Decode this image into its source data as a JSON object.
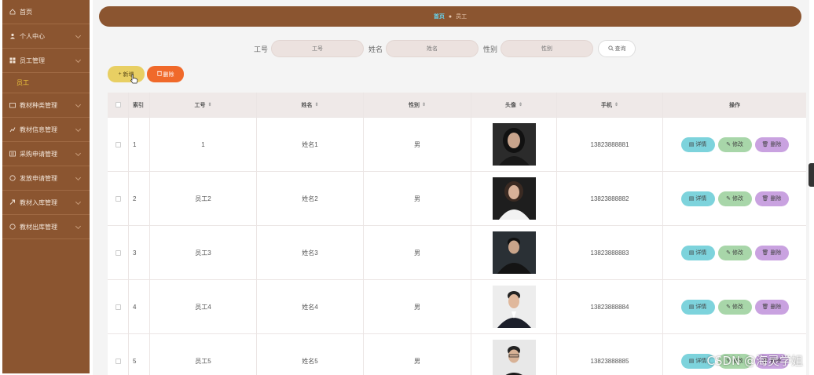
{
  "sidebar": {
    "items": [
      {
        "label": "首页",
        "icon": "home-icon"
      },
      {
        "label": "个人中心",
        "icon": "user-icon"
      },
      {
        "label": "员工管理",
        "icon": "grid-icon"
      },
      {
        "label": "教材种类管理",
        "icon": "folder-icon"
      },
      {
        "label": "教材信息管理",
        "icon": "chart-icon"
      },
      {
        "label": "采购申请管理",
        "icon": "list-icon"
      },
      {
        "label": "发放申请管理",
        "icon": "circle-icon"
      },
      {
        "label": "教材入库管理",
        "icon": "box-icon"
      },
      {
        "label": "教材出库管理",
        "icon": "circle-icon"
      }
    ],
    "sub_item": "员工"
  },
  "breadcrumb": {
    "home": "首页",
    "current": "员工"
  },
  "search": {
    "gonghao_label": "工号",
    "gonghao_placeholder": "工号",
    "name_label": "姓名",
    "name_placeholder": "姓名",
    "gender_label": "性别",
    "gender_placeholder": "性别",
    "button": "查询"
  },
  "actions": {
    "add": "新增",
    "delete": "删除"
  },
  "table": {
    "headers": {
      "index": "索引",
      "gonghao": "工号",
      "name": "姓名",
      "gender": "性别",
      "avatar": "头像",
      "phone": "手机",
      "ops": "操作"
    },
    "rows": [
      {
        "index": "1",
        "gonghao": "1",
        "name": "姓名1",
        "gender": "男",
        "phone": "13823888881"
      },
      {
        "index": "2",
        "gonghao": "员工2",
        "name": "姓名2",
        "gender": "男",
        "phone": "13823888882"
      },
      {
        "index": "3",
        "gonghao": "员工3",
        "name": "姓名3",
        "gender": "男",
        "phone": "13823888883"
      },
      {
        "index": "4",
        "gonghao": "员工4",
        "name": "姓名4",
        "gender": "男",
        "phone": "13823888884"
      },
      {
        "index": "5",
        "gonghao": "员工5",
        "name": "姓名5",
        "gender": "男",
        "phone": "13823888885"
      }
    ],
    "op_labels": {
      "detail": "详情",
      "edit": "修改",
      "delete": "删除"
    }
  },
  "watermark": "CSDN @海灵学姐",
  "colors": {
    "sidebar": "#8b5530",
    "accent_yellow": "#e8cf63",
    "accent_orange": "#f0692a",
    "detail": "#7dd3dc",
    "edit": "#a8d6a9",
    "delete": "#c9a2e0"
  }
}
